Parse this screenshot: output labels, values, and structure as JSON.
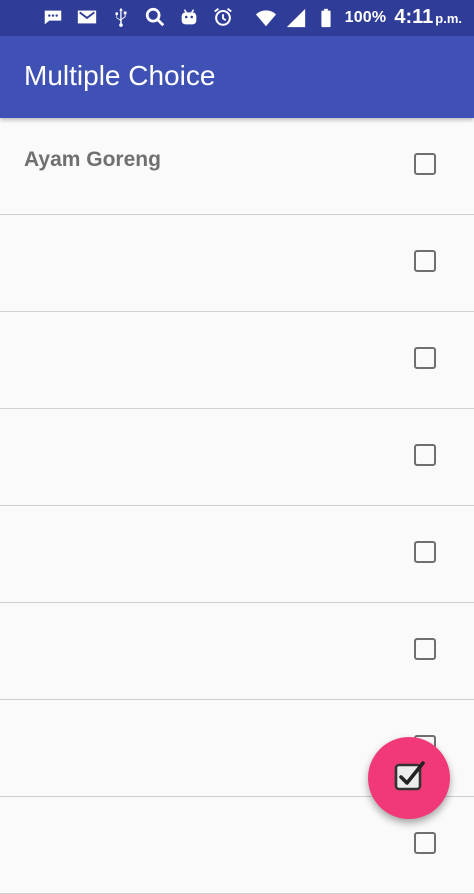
{
  "status_bar": {
    "icons_left": [
      "chat-icon",
      "gmail-icon",
      "usb-icon",
      "search-icon",
      "android-icon",
      "alarm-icon"
    ],
    "icons_right": [
      "wifi-icon",
      "signal-icon",
      "battery-icon"
    ],
    "battery": "100%",
    "time": "4:11",
    "ampm": "p.m."
  },
  "app_bar": {
    "title": "Multiple Choice"
  },
  "list": {
    "items": [
      {
        "label": "Ayam Goreng",
        "checked": false
      },
      {
        "label": "",
        "checked": false
      },
      {
        "label": "",
        "checked": false
      },
      {
        "label": "",
        "checked": false
      },
      {
        "label": "",
        "checked": false
      },
      {
        "label": "",
        "checked": false
      },
      {
        "label": "",
        "checked": false
      },
      {
        "label": "",
        "checked": false
      }
    ]
  },
  "fab": {
    "icon": "check-box-icon",
    "color": "#f1397a"
  },
  "colors": {
    "status_bar": "#2f3d98",
    "app_bar": "#3f51b5",
    "background": "#fafafa"
  }
}
